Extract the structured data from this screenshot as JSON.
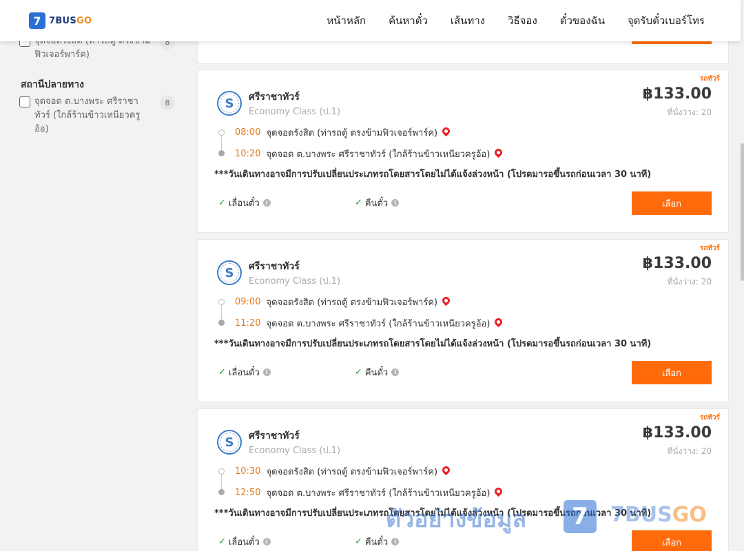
{
  "header": {
    "logo_mark": "7",
    "logo_text": "7BUS",
    "logo_text_go": "GO",
    "nav": [
      "หน้าหลัก",
      "ค้นหาตั๋ว",
      "เส้นทาง",
      "วิธีจอง",
      "ตั๋วของฉัน",
      "จุดรับตั๋วเบอร์โทร"
    ]
  },
  "sidebar": {
    "origin_item": {
      "label": "จุดจอดรังสิต (ท่ารถตู้ ตรงข้ามฟิวเจอร์พาร์ค)",
      "count": "8"
    },
    "destination_title": "สถานีปลายทาง",
    "destination_item": {
      "label": "จุดจอด ต.บางพระ ศรีราชาทัวร์ (ใกล้ร้านข้าวเหนียวครูอ้อ)",
      "count": "8"
    }
  },
  "trips": [
    {
      "tag": "รถทัวร์",
      "operator": "ศรีราชาทัวร์",
      "class": "Economy Class (ป.1)",
      "price": "฿133.00",
      "seats": "ที่นั่งว่าง: 20",
      "depart_time": "08:00",
      "depart_place": "จุดจอดรังสิต (ท่ารถตู้ ตรงข้ามฟิวเจอร์พาร์ค)",
      "arrive_time": "10:20",
      "arrive_place": "จุดจอด ต.บางพระ ศรีราชาทัวร์ (ใกล้ร้านข้าวเหนียวครูอ้อ)",
      "notice": "***วันเดินทางอาจมีการปรับเปลี่ยนประเภทรถโดยสารโดยไม่ได้แจ้งล่วงหน้า (โปรดมารอขึ้นรถก่อนเวลา 30 นาที)",
      "reschedule": "เลื่อนตั๋ว",
      "refund": "คืนตั๋ว",
      "select": "เลือก"
    },
    {
      "tag": "รถทัวร์",
      "operator": "ศรีราชาทัวร์",
      "class": "Economy Class (ป.1)",
      "price": "฿133.00",
      "seats": "ที่นั่งว่าง: 20",
      "depart_time": "09:00",
      "depart_place": "จุดจอดรังสิต (ท่ารถตู้ ตรงข้ามฟิวเจอร์พาร์ค)",
      "arrive_time": "11:20",
      "arrive_place": "จุดจอด ต.บางพระ ศรีราชาทัวร์ (ใกล้ร้านข้าวเหนียวครูอ้อ)",
      "notice": "***วันเดินทางอาจมีการปรับเปลี่ยนประเภทรถโดยสารโดยไม่ได้แจ้งล่วงหน้า (โปรดมารอขึ้นรถก่อนเวลา 30 นาที)",
      "reschedule": "เลื่อนตั๋ว",
      "refund": "คืนตั๋ว",
      "select": "เลือก"
    },
    {
      "tag": "รถทัวร์",
      "operator": "ศรีราชาทัวร์",
      "class": "Economy Class (ป.1)",
      "price": "฿133.00",
      "seats": "ที่นั่งว่าง: 20",
      "depart_time": "10:30",
      "depart_place": "จุดจอดรังสิต (ท่ารถตู้ ตรงข้ามฟิวเจอร์พาร์ค)",
      "arrive_time": "12:50",
      "arrive_place": "จุดจอด ต.บางพระ ศรีราชาทัวร์ (ใกล้ร้านข้าวเหนียวครูอ้อ)",
      "notice": "***วันเดินทางอาจมีการปรับเปลี่ยนประเภทรถโดยสารโดยไม่ได้แจ้งล่วงหน้า (โปรดมารอขึ้นรถก่อนเวลา 30 นาที)",
      "reschedule": "เลื่อนตั๋ว",
      "refund": "คืนตั๋ว",
      "select": "เลือก"
    }
  ],
  "watermark": {
    "text": "ตัวอย่างข้อมูล",
    "logo_mark": "7",
    "brand": "7BUS",
    "brand_go": "GO"
  },
  "colors": {
    "accent": "#ff6b0a",
    "time": "#e07a1b",
    "brand_blue": "#2a6fd6",
    "check": "#2e9a3c",
    "pin": "#e8232a"
  }
}
